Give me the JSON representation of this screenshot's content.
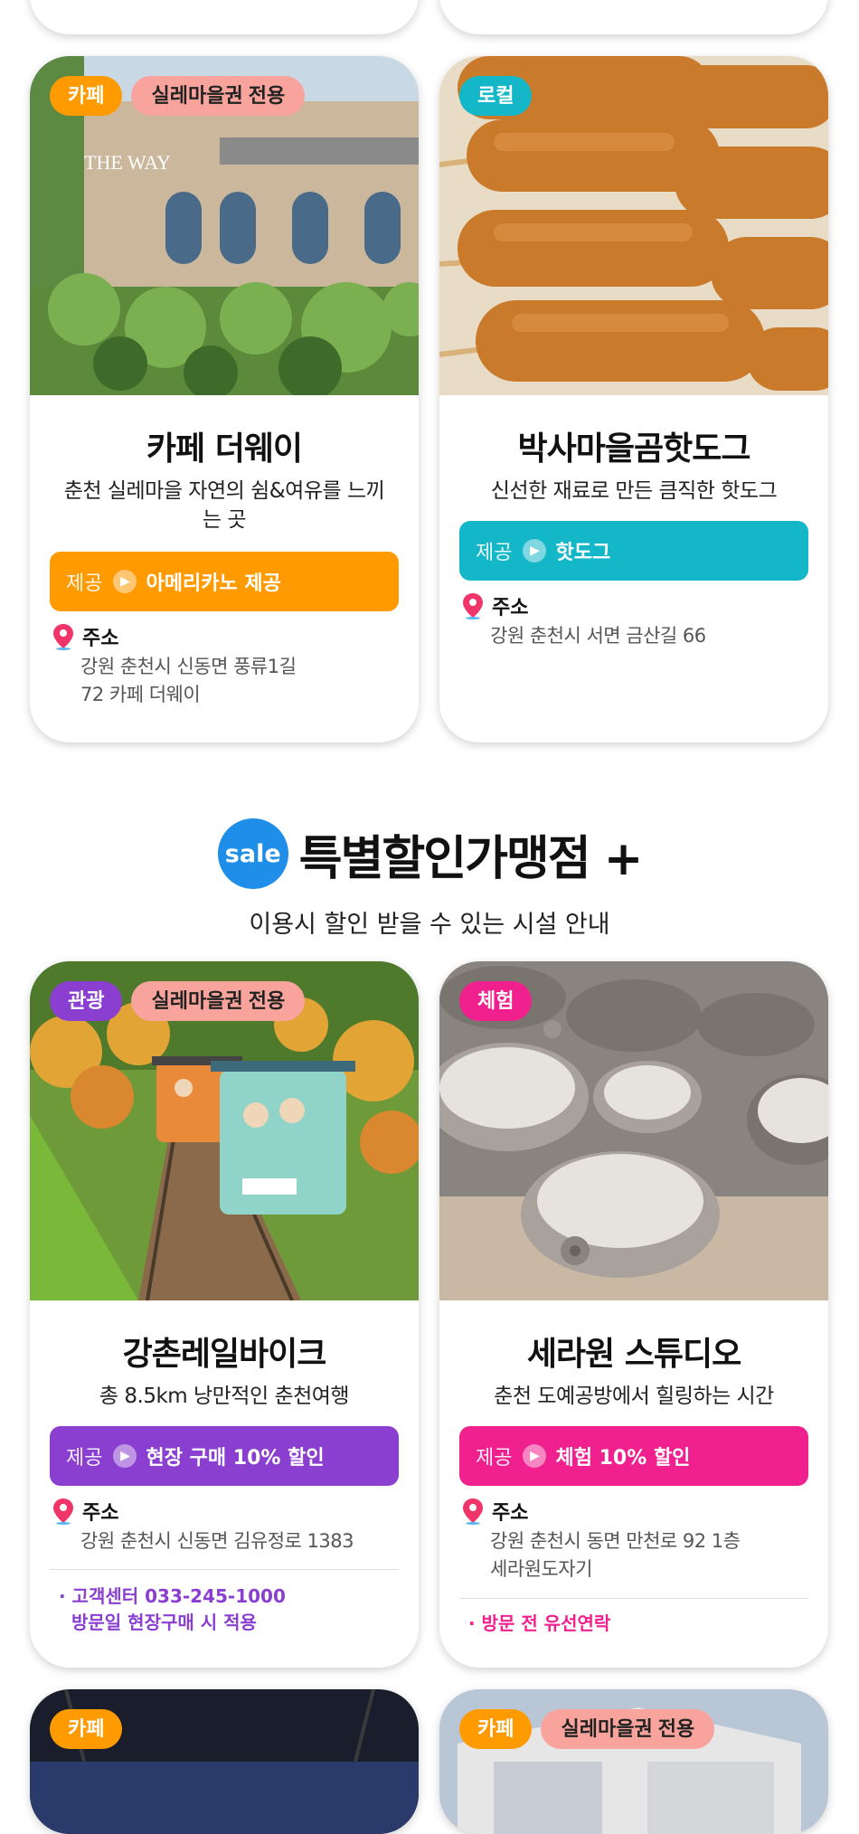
{
  "colors": {
    "cafe": "#ff9a00",
    "local": "#14b7c8",
    "tour": "#8a3fd1",
    "experience": "#f0218f",
    "exclusive": "#f8a39b",
    "sale": "#1f8ee8"
  },
  "cards_top": [
    {
      "category": "카페",
      "exclusive": "실레마을권 전용",
      "name": "카페 더웨이",
      "desc": "춘천 실레마을 자연의 쉼&여유를 느끼는 곳",
      "offer_label": "제공",
      "offer_value": "아메리카노 제공",
      "address_label": "주소",
      "address": "강원 춘천시 신동면 풍류1길 72 카페 더웨이",
      "photo_icon": "cafe-building-photo"
    },
    {
      "category": "로컬",
      "name": "박사마을곰핫도그",
      "desc": "신선한 재료로 만든 큼직한 핫도그",
      "offer_label": "제공",
      "offer_value": "핫도그",
      "address_label": "주소",
      "address": "강원 춘천시 서면 금산길 66",
      "photo_icon": "corndog-photo"
    }
  ],
  "section": {
    "sale_badge": "sale",
    "title": "특별할인가맹점 +",
    "subtitle": "이용시 할인 받을 수 있는 시설 안내"
  },
  "cards_bottom": [
    {
      "category": "관광",
      "exclusive": "실레마을권 전용",
      "name": "강촌레일바이크",
      "desc": "총 8.5km 낭만적인 춘천여행",
      "offer_label": "제공",
      "offer_value": "현장 구매 10% 할인",
      "address_label": "주소",
      "address": "강원 춘천시 신동면 김유정로 1383",
      "note_1": "· 고객센터 033-245-1000",
      "note_2": "방문일 현장구매 시 적용",
      "photo_icon": "railbike-photo"
    },
    {
      "category": "체험",
      "name": "세라원 스튜디오",
      "desc": "춘천 도예공방에서 힐링하는 시간",
      "offer_label": "제공",
      "offer_value": "체험 10% 할인",
      "address_label": "주소",
      "address": "강원 춘천시 동면 만천로 92 1층 세라원도자기",
      "note_1": "· 방문 전 유선연락",
      "photo_icon": "pottery-photo"
    }
  ],
  "cards_next": [
    {
      "category": "카페"
    },
    {
      "category": "카페",
      "exclusive": "실레마을권 전용"
    }
  ]
}
